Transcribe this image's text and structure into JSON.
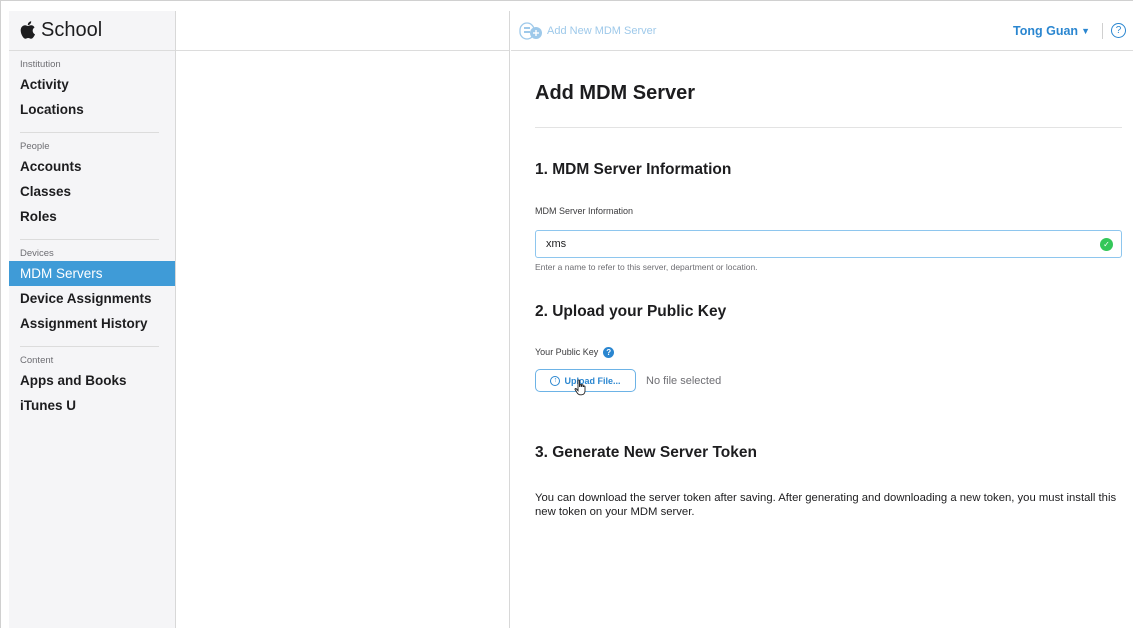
{
  "sidebar": {
    "brand": "School",
    "sections": [
      {
        "title": "Institution",
        "items": [
          "Activity",
          "Locations"
        ]
      },
      {
        "title": "People",
        "items": [
          "Accounts",
          "Classes",
          "Roles"
        ]
      },
      {
        "title": "Devices",
        "items": [
          "MDM Servers",
          "Device Assignments",
          "Assignment History"
        ]
      },
      {
        "title": "Content",
        "items": [
          "Apps and Books",
          "iTunes U"
        ]
      }
    ],
    "active_item": "MDM Servers"
  },
  "topbar": {
    "breadcrumb": "Add New MDM Server",
    "user_name": "Tong Guan",
    "user_menu_icon": "chevron-down-icon",
    "help_icon": "question-mark-icon"
  },
  "main": {
    "title": "Add MDM Server",
    "section1": {
      "heading": "1. MDM Server Information",
      "field_label": "MDM Server Information",
      "field_value": "xms",
      "field_help": "Enter a name to refer to this server, department or location."
    },
    "section2": {
      "heading": "2. Upload your Public Key",
      "field_label": "Your Public Key",
      "upload_button": "Upload File...",
      "file_status": "No file selected"
    },
    "section3": {
      "heading": "3. Generate New Server Token",
      "description": "You can download the server token after saving. After generating and downloading a new token, you must install this new token on your MDM server."
    }
  },
  "colors": {
    "accent": "#2a86d0",
    "active_nav_bg": "#3f9bd7",
    "valid_check": "#34c759",
    "sidebar_bg": "#f5f5f7"
  }
}
